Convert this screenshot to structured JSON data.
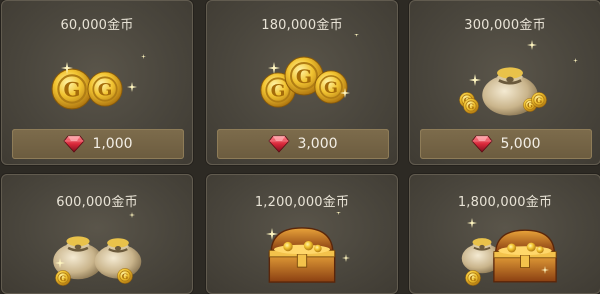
{
  "items": [
    {
      "title": "60,000金币",
      "price": "1,000",
      "art": "gold-coins-icon"
    },
    {
      "title": "180,000金币",
      "price": "3,000",
      "art": "gold-coins-icon"
    },
    {
      "title": "300,000金币",
      "price": "5,000",
      "art": "coin-bag-icon"
    },
    {
      "title": "600,000金币",
      "price": "",
      "art": "coin-bags-icon"
    },
    {
      "title": "1,200,000金币",
      "price": "",
      "art": "treasure-chest-icon"
    },
    {
      "title": "1,800,000金币",
      "price": "",
      "art": "treasure-chest-bags-icon"
    }
  ],
  "currency_icon": "ruby-gem-icon",
  "colors": {
    "gold": "#e6b422",
    "ruby": "#c8283a",
    "price_bar": "#75644a"
  }
}
